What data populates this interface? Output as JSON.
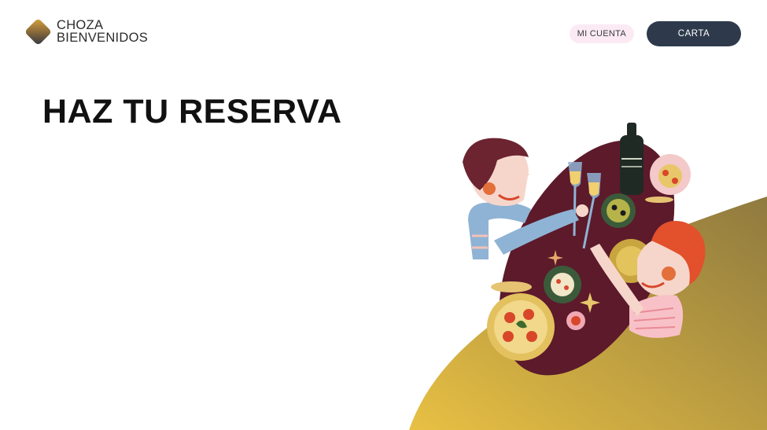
{
  "brand": {
    "line1": "CHOZA",
    "line2": "BIENVENIDOS"
  },
  "nav": {
    "account_label": "MI CUENTA",
    "menu_label": "CARTA"
  },
  "hero": {
    "title": "HAZ TU RESERVA"
  },
  "colors": {
    "menu_button": "#2e3a4c",
    "account_button": "#fbeaf4",
    "gold_gradient_start": "#e8c043",
    "gold_gradient_end": "#8f7a3f",
    "table_wine": "#5c1a2b"
  }
}
